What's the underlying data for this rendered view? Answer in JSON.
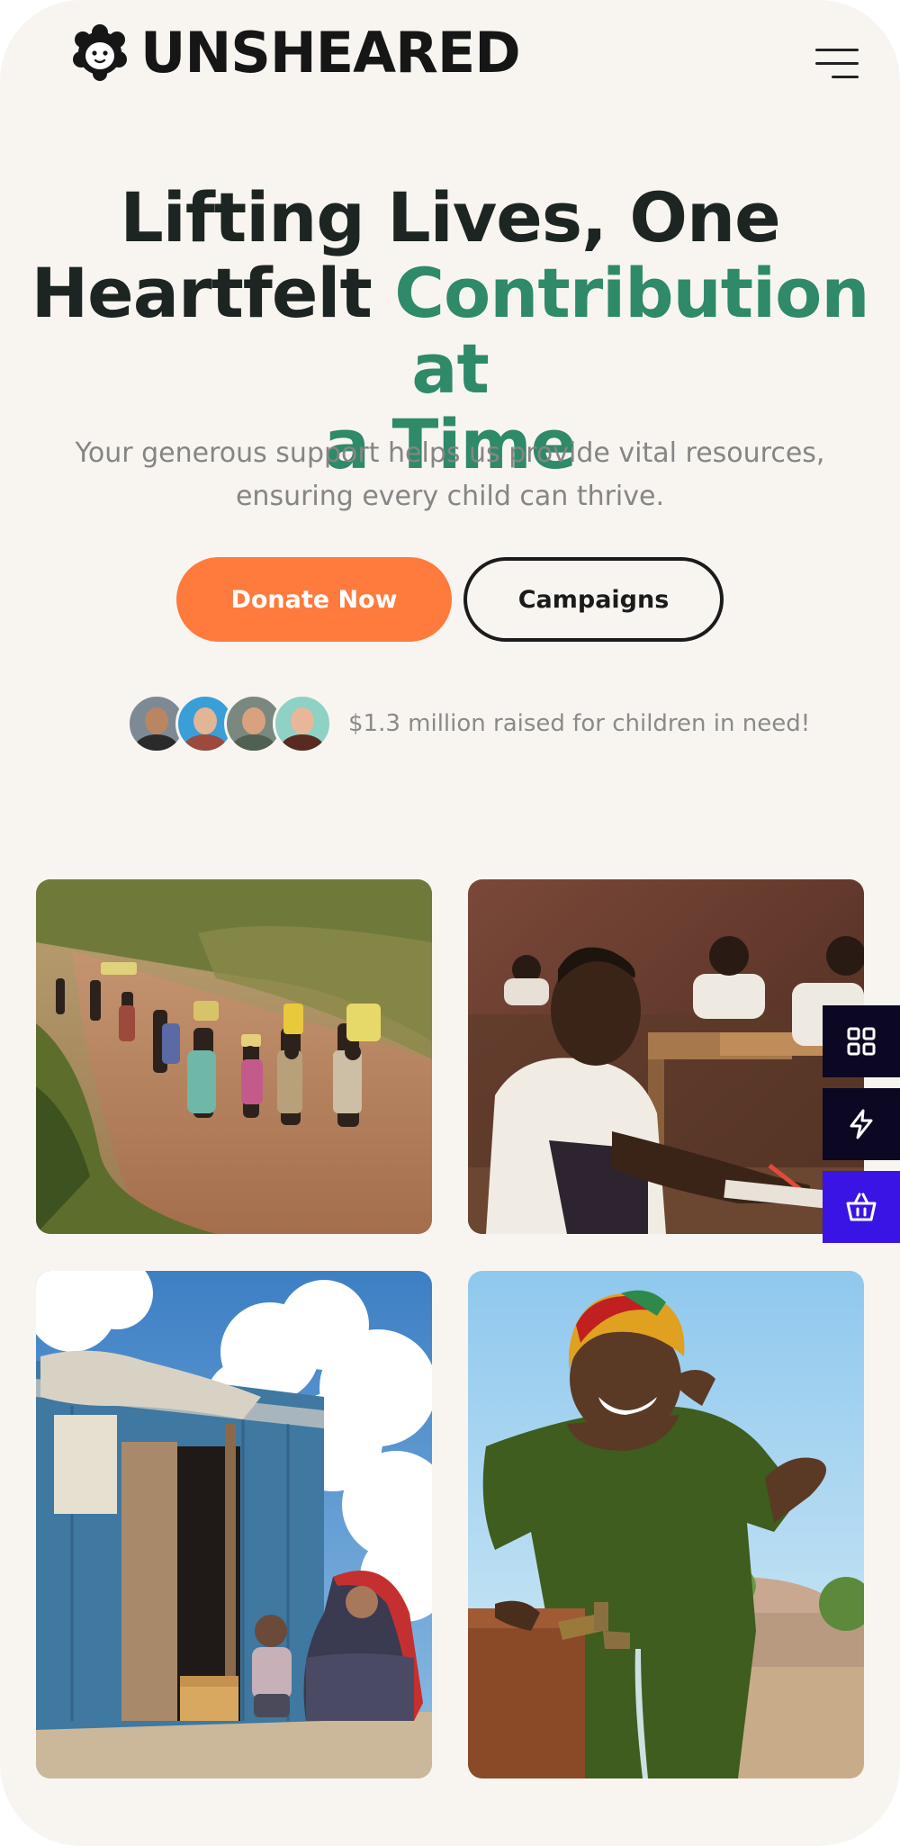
{
  "brand": {
    "name": "UNSHEARED",
    "logo_icon": "sheep-icon"
  },
  "header": {
    "menu_icon": "hamburger-menu-icon"
  },
  "hero": {
    "title_line1": "Lifting Lives, One",
    "title_line2_plain": "Heartfelt ",
    "title_line2_accent": "Contribution at",
    "title_line3_accent": "a Time",
    "subtitle": "Your generous support helps us provide vital resources, ensuring every child can thrive.",
    "cta_primary": "Donate Now",
    "cta_secondary": "Campaigns",
    "raised_text": "$1.3 million raised for children in need!"
  },
  "colors": {
    "accent_green": "#2e8a68",
    "donate_orange": "#ff7a3d",
    "toolbar_dark": "#0c0722",
    "toolbar_purple": "#3a14e4",
    "page_bg": "#f8f5f0"
  },
  "side_toolbar": [
    {
      "icon": "grid-icon"
    },
    {
      "icon": "lightning-icon"
    },
    {
      "icon": "basket-icon"
    }
  ]
}
